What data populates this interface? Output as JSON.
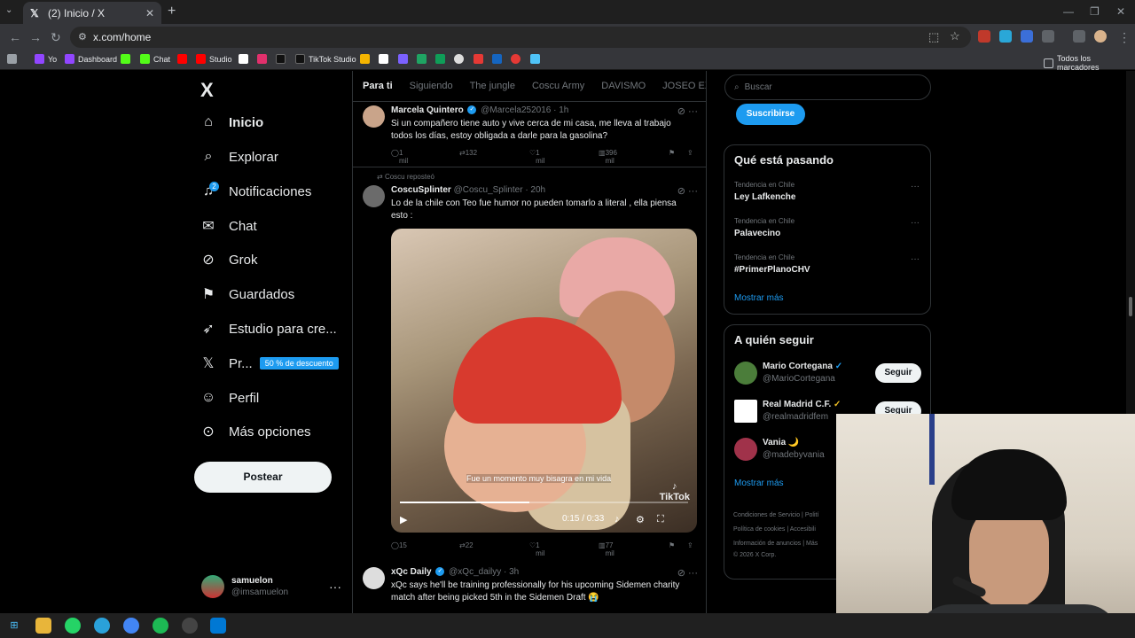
{
  "browser": {
    "tab_title": "(2) Inicio / X",
    "url": "x.com/home",
    "bookmarks": [
      "Yo",
      "Dashboard",
      "Chat",
      "Studio",
      "TikTok Studio"
    ],
    "bookmarks_folder": "Todos los marcadores"
  },
  "sidebar": {
    "logo": "X",
    "items": [
      {
        "label": "Inicio",
        "icon": "home-icon"
      },
      {
        "label": "Explorar",
        "icon": "search-icon"
      },
      {
        "label": "Notificaciones",
        "icon": "bell-icon"
      },
      {
        "label": "Chat",
        "icon": "mail-icon"
      },
      {
        "label": "Grok",
        "icon": "grok-icon"
      },
      {
        "label": "Guardados",
        "icon": "bookmark-icon"
      },
      {
        "label": "Estudio para cre...",
        "icon": "rocket-icon"
      },
      {
        "label": "Pr...",
        "icon": "x-icon"
      },
      {
        "label": "Perfil",
        "icon": "person-icon"
      },
      {
        "label": "Más opciones",
        "icon": "more-circle-icon"
      }
    ],
    "notification_count": "2",
    "premium_promo": "50 % de descuento",
    "post_button": "Postear",
    "profile": {
      "name": "samuelon",
      "handle": "@imsamuelon"
    }
  },
  "timeline": {
    "tabs": [
      "Para ti",
      "Siguiendo",
      "The jungle",
      "Coscu Army",
      "DAVISMO",
      "JOSEO EXC"
    ],
    "tweets": [
      {
        "name": "Marcela Quintero",
        "handle": "@Marcela252016",
        "time": "· 1h",
        "text": "Si un compañero tiene auto y vive cerca de mi casa, me lleva al trabajo todos los días, estoy obligada a darle para la gasolina?",
        "replies": "1 mil",
        "reposts": "132",
        "likes": "1 mil",
        "views": "396 mil"
      },
      {
        "repost_note": "Coscu reposteó",
        "name": "CoscuSplinter",
        "handle": "@Coscu_Splinter",
        "time": "· 20h",
        "text": "Lo de la chile con Teo fue humor no pueden tomarlo a literal , ella piensa esto :",
        "video_caption": "Fue un momento muy bisagra en mi vida",
        "video_time": "0:15 / 0:33",
        "video_progress": 0.45,
        "watermark": "TikTok",
        "replies": "15",
        "reposts": "22",
        "likes": "1 mil",
        "views": "77 mil"
      },
      {
        "name": "xQc Daily",
        "handle": "@xQc_dailyy",
        "time": "· 3h",
        "text": "xQc says he'll be training professionally for his upcoming Sidemen charity match after being picked 5th in the Sidemen Draft 😭"
      }
    ]
  },
  "right": {
    "search_placeholder": "Buscar",
    "subscribe": "Suscribirse",
    "trends_title": "Qué está pasando",
    "trends": [
      {
        "context": "Tendencia en Chile",
        "name": "Ley Lafkenche"
      },
      {
        "context": "Tendencia en Chile",
        "name": "Palavecino"
      },
      {
        "context": "Tendencia en Chile",
        "name": "#PrimerPlanoCHV"
      }
    ],
    "show_more": "Mostrar más",
    "follow_title": "A quién seguir",
    "follow": [
      {
        "name": "Mario Cortegana",
        "handle": "@MarioCortegana",
        "button": "Seguir"
      },
      {
        "name": "Real Madrid C.F.",
        "handle": "@realmadridfem",
        "button": "Seguir"
      },
      {
        "name": "Vania 🌙",
        "handle": "@madebyvania"
      }
    ],
    "footer": [
      "Condiciones de Servicio",
      "Polití",
      "Política de cookies",
      "Accesibili",
      "Información de anuncios",
      "Más",
      "© 2026 X Corp."
    ]
  },
  "colors": {
    "accent": "#1d9bf0",
    "bg": "#000000",
    "border": "#2f3336"
  }
}
